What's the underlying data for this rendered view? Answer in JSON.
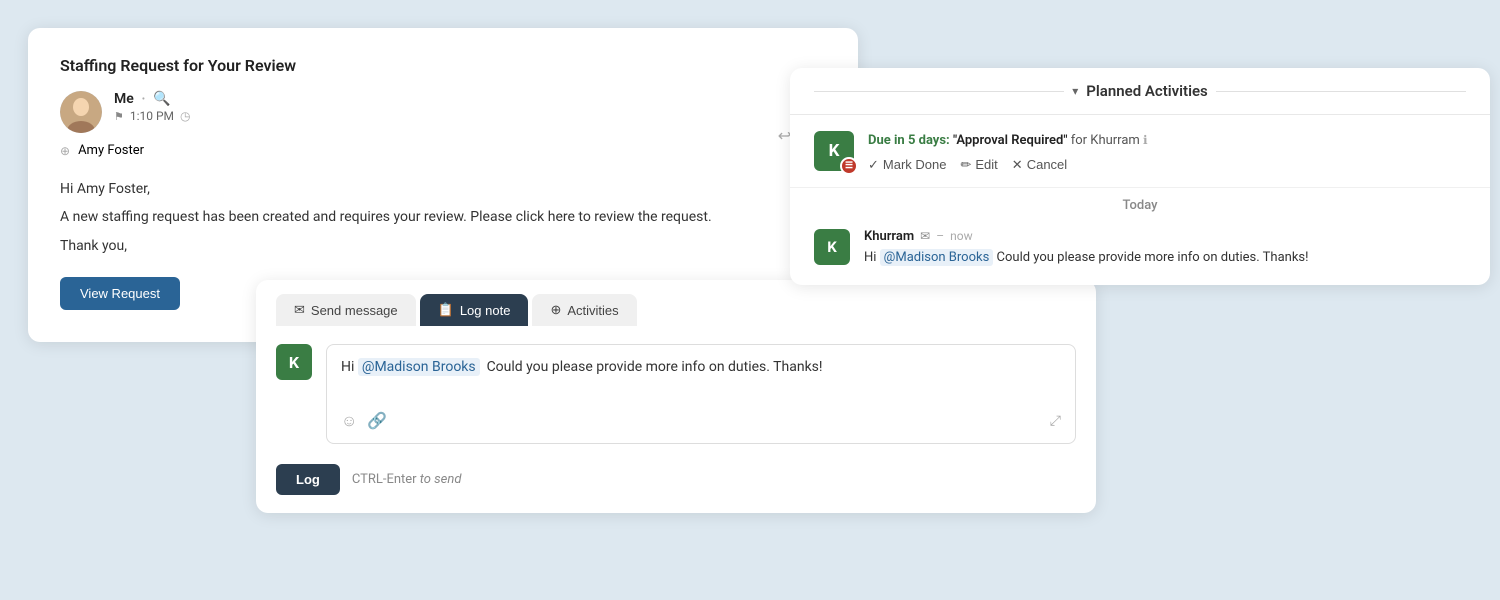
{
  "email_card": {
    "subject": "Staffing Request for Your Review",
    "sender": "Me",
    "time": "1:10 PM",
    "recipient": "Amy Foster",
    "body_line1": "Hi Amy Foster,",
    "body_line2": "A new staffing request has been created and requires your review. Please click here to review the request.",
    "body_line3": "Thank you,",
    "view_request_btn": "View Request"
  },
  "composer": {
    "tab_send": "Send message",
    "tab_log": "Log note",
    "tab_activities": "Activities",
    "avatar_letter": "K",
    "message_text": "Hi @Madison Brooks  Could you please provide more info on duties. Thanks!",
    "mention": "@Madison Brooks",
    "log_btn": "Log",
    "send_hint": "CTRL-Enter",
    "send_hint_italic": " to send"
  },
  "planned_activities": {
    "title": "Planned Activities",
    "due_label": "Due in 5 days:",
    "due_title": "\"Approval Required\"",
    "due_for": "for Khurram",
    "mark_done": "Mark Done",
    "edit": "Edit",
    "cancel": "Cancel",
    "today_label": "Today",
    "chat_sender": "Khurram",
    "chat_time": "now",
    "chat_mention": "@Madison Brooks",
    "chat_message": " Could you please provide more info on duties. Thanks!"
  },
  "icons": {
    "search": "🔍",
    "flag": "⚑",
    "clock": "◷",
    "reply": "↩",
    "reply_all": "↩↩",
    "envelope": "✉",
    "log_note_icon": "📋",
    "activities_icon": "⊕",
    "emoji": "☺",
    "attachment": "🔗",
    "expand": "⤢",
    "checkmark": "✓",
    "pencil": "✏",
    "x": "✕",
    "chevron_down": "▾",
    "info": "ℹ",
    "expand_arrows": "⤢"
  }
}
